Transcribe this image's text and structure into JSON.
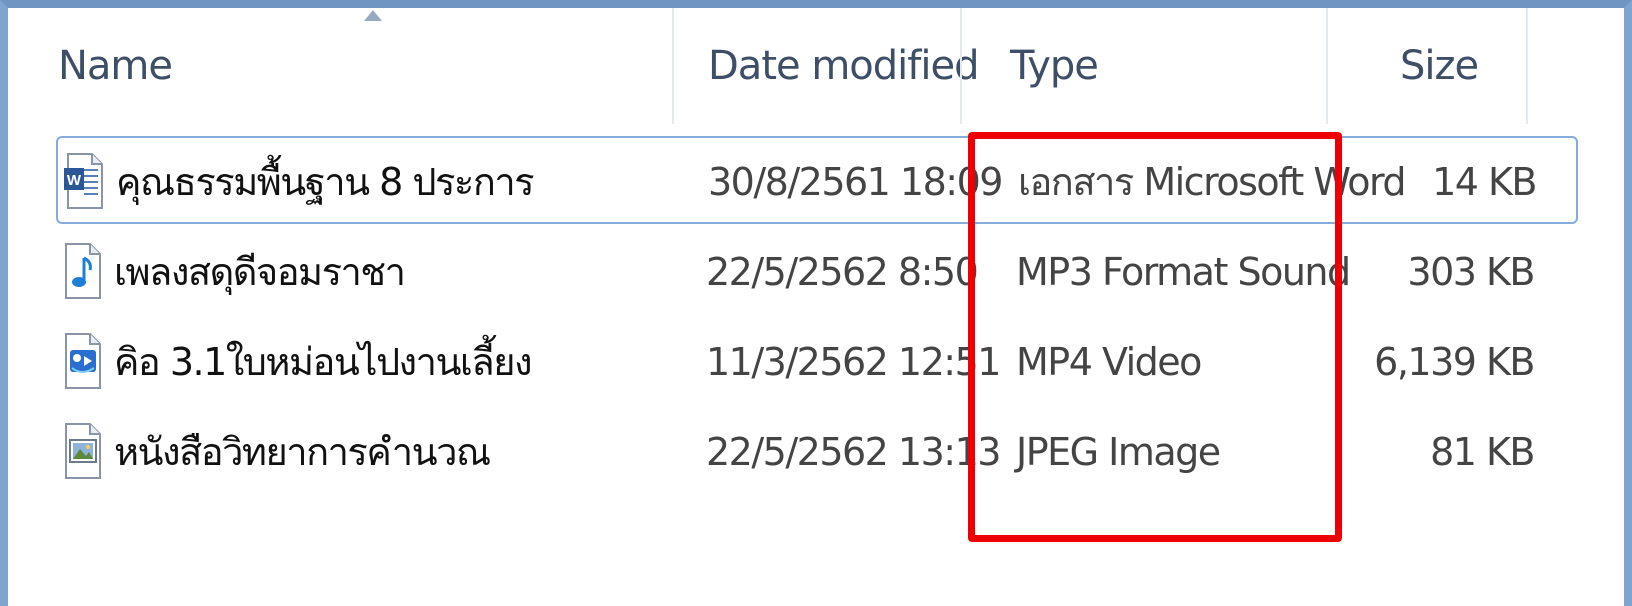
{
  "columns": {
    "name": "Name",
    "date_modified": "Date modified",
    "type": "Type",
    "size": "Size"
  },
  "sort": {
    "column": "name",
    "direction": "ascending"
  },
  "files": [
    {
      "name": "คุณธรรมพื้นฐาน 8 ประการ",
      "date": "30/8/2561 18:09",
      "type": "เอกสาร Microsoft Word",
      "size": "14 KB",
      "icon": "word-document-icon",
      "selected": true
    },
    {
      "name": "เพลงสดุดีจอมราชา",
      "date": "22/5/2562 8:50",
      "type": "MP3 Format Sound",
      "size": "303 KB",
      "icon": "audio-file-icon",
      "selected": false
    },
    {
      "name": "คิอ 3.1ใบหม่อนไปงานเลี้ยง",
      "date": "11/3/2562 12:51",
      "type": "MP4 Video",
      "size": "6,139 KB",
      "icon": "video-file-icon",
      "selected": false
    },
    {
      "name": "หนังสือวิทยาการคำนวณ",
      "date": "22/5/2562 13:13",
      "type": "JPEG Image",
      "size": "81 KB",
      "icon": "image-file-icon",
      "selected": false
    }
  ],
  "colors": {
    "highlight": "#ee0000",
    "selection_border": "#84acdd",
    "window_border": "#7ea4cf",
    "header_text": "#3d4e66"
  }
}
